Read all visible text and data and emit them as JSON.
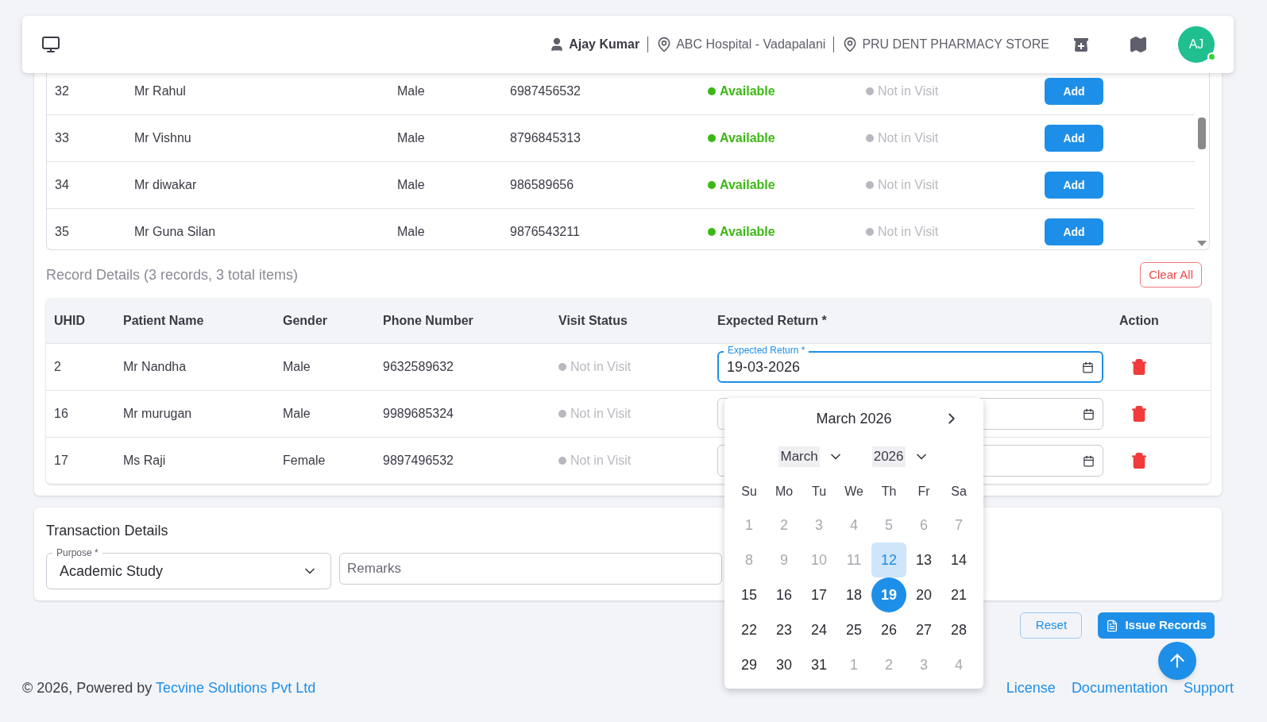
{
  "header": {
    "user": "Ajay Kumar",
    "hospital": "ABC Hospital - Vadapalani",
    "store": "PRU DENT PHARMACY STORE",
    "avatar": "AJ",
    "online": true
  },
  "patients": {
    "rows": [
      {
        "uhid": "32",
        "name": "Mr Rahul",
        "gender": "Male",
        "phone": "6987456532",
        "availability": "Available",
        "visit_status": "Not in Visit",
        "action": "Add"
      },
      {
        "uhid": "33",
        "name": "Mr Vishnu",
        "gender": "Male",
        "phone": "8796845313",
        "availability": "Available",
        "visit_status": "Not in Visit",
        "action": "Add"
      },
      {
        "uhid": "34",
        "name": "Mr diwakar",
        "gender": "Male",
        "phone": "986589656",
        "availability": "Available",
        "visit_status": "Not in Visit",
        "action": "Add"
      },
      {
        "uhid": "35",
        "name": "Mr Guna Silan",
        "gender": "Male",
        "phone": "9876543211",
        "availability": "Available",
        "visit_status": "Not in Visit",
        "action": "Add"
      }
    ]
  },
  "records": {
    "title": "Record Details (3 records, 3 total items)",
    "clear_button": "Clear All",
    "columns": [
      "UHID",
      "Patient Name",
      "Gender",
      "Phone Number",
      "Visit Status",
      "Expected Return *",
      "Action"
    ],
    "rows": [
      {
        "uhid": "2",
        "name": "Mr Nandha",
        "gender": "Male",
        "phone": "9632589632",
        "visit_status": "Not in Visit",
        "return_field": {
          "label": "Expected Return *",
          "value": "19-03-2026",
          "focused": true
        }
      },
      {
        "uhid": "16",
        "name": "Mr murugan",
        "gender": "Male",
        "phone": "9989685324",
        "visit_status": "Not in Visit",
        "return_field": {
          "focused": false
        }
      },
      {
        "uhid": "17",
        "name": "Ms Raji",
        "gender": "Female",
        "phone": "9897496532",
        "visit_status": "Not in Visit",
        "return_field": {
          "focused": false
        }
      }
    ]
  },
  "transaction": {
    "title": "Transaction Details",
    "purpose": {
      "label": "Purpose *",
      "value": "Academic Study"
    },
    "remarks": {
      "placeholder": "Remarks"
    }
  },
  "actions": {
    "reset": "Reset",
    "issue": "Issue Records"
  },
  "calendar": {
    "title": "March 2026",
    "month": "March",
    "year": "2026",
    "weekdays": [
      "Su",
      "Mo",
      "Tu",
      "We",
      "Th",
      "Fr",
      "Sa"
    ],
    "days": [
      {
        "label": "1",
        "kind": "disabled",
        "selected": false
      },
      {
        "label": "2",
        "kind": "disabled",
        "selected": false
      },
      {
        "label": "3",
        "kind": "disabled",
        "selected": false
      },
      {
        "label": "4",
        "kind": "disabled",
        "selected": false
      },
      {
        "label": "5",
        "kind": "disabled",
        "selected": false
      },
      {
        "label": "6",
        "kind": "disabled",
        "selected": false
      },
      {
        "label": "7",
        "kind": "disabled",
        "selected": false
      },
      {
        "label": "8",
        "kind": "disabled",
        "selected": false
      },
      {
        "label": "9",
        "kind": "disabled",
        "selected": false
      },
      {
        "label": "10",
        "kind": "disabled",
        "selected": false
      },
      {
        "label": "11",
        "kind": "disabled",
        "selected": false
      },
      {
        "label": "12",
        "kind": "today",
        "selected": false
      },
      {
        "label": "13",
        "kind": "normal",
        "selected": false
      },
      {
        "label": "14",
        "kind": "normal",
        "selected": false
      },
      {
        "label": "15",
        "kind": "normal",
        "selected": false
      },
      {
        "label": "16",
        "kind": "normal",
        "selected": false
      },
      {
        "label": "17",
        "kind": "normal",
        "selected": false
      },
      {
        "label": "18",
        "kind": "normal",
        "selected": false
      },
      {
        "label": "19",
        "kind": "normal",
        "selected": true
      },
      {
        "label": "20",
        "kind": "normal",
        "selected": false
      },
      {
        "label": "21",
        "kind": "normal",
        "selected": false
      },
      {
        "label": "22",
        "kind": "normal",
        "selected": false
      },
      {
        "label": "23",
        "kind": "normal",
        "selected": false
      },
      {
        "label": "24",
        "kind": "normal",
        "selected": false
      },
      {
        "label": "25",
        "kind": "normal",
        "selected": false
      },
      {
        "label": "26",
        "kind": "normal",
        "selected": false
      },
      {
        "label": "27",
        "kind": "normal",
        "selected": false
      },
      {
        "label": "28",
        "kind": "normal",
        "selected": false
      },
      {
        "label": "29",
        "kind": "normal",
        "selected": false
      },
      {
        "label": "30",
        "kind": "normal",
        "selected": false
      },
      {
        "label": "31",
        "kind": "normal",
        "selected": false
      },
      {
        "label": "1",
        "kind": "outside",
        "selected": false
      },
      {
        "label": "2",
        "kind": "outside",
        "selected": false
      },
      {
        "label": "3",
        "kind": "outside",
        "selected": false
      },
      {
        "label": "4",
        "kind": "outside",
        "selected": false
      }
    ]
  },
  "footer": {
    "copyright": "© 2026, Powered by ",
    "company": "Tecvine Solutions Pvt Ltd",
    "links": [
      "License",
      "Documentation",
      "Support"
    ]
  }
}
